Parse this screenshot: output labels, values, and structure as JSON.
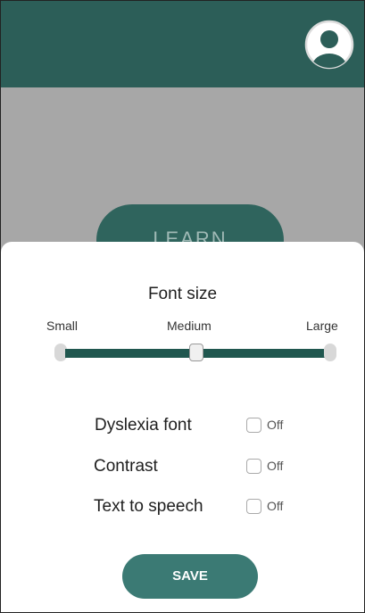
{
  "header": {
    "profile_icon": "user-circle-icon"
  },
  "background": {
    "learn_label": "LEARN"
  },
  "font_size": {
    "title": "Font size",
    "ticks": [
      "Small",
      "Medium",
      "Large"
    ],
    "selected": "Medium",
    "level": 0.5
  },
  "settings": [
    {
      "label": "Dyslexia font",
      "state": "Off"
    },
    {
      "label": "Contrast",
      "state": "Off"
    },
    {
      "label": "Text to speech",
      "state": "Off"
    }
  ],
  "save_label": "SAVE",
  "colors": {
    "header": "#2c5e58",
    "accent": "#20574f",
    "save": "#3b7a74",
    "backdrop": "#a7a7a7"
  }
}
